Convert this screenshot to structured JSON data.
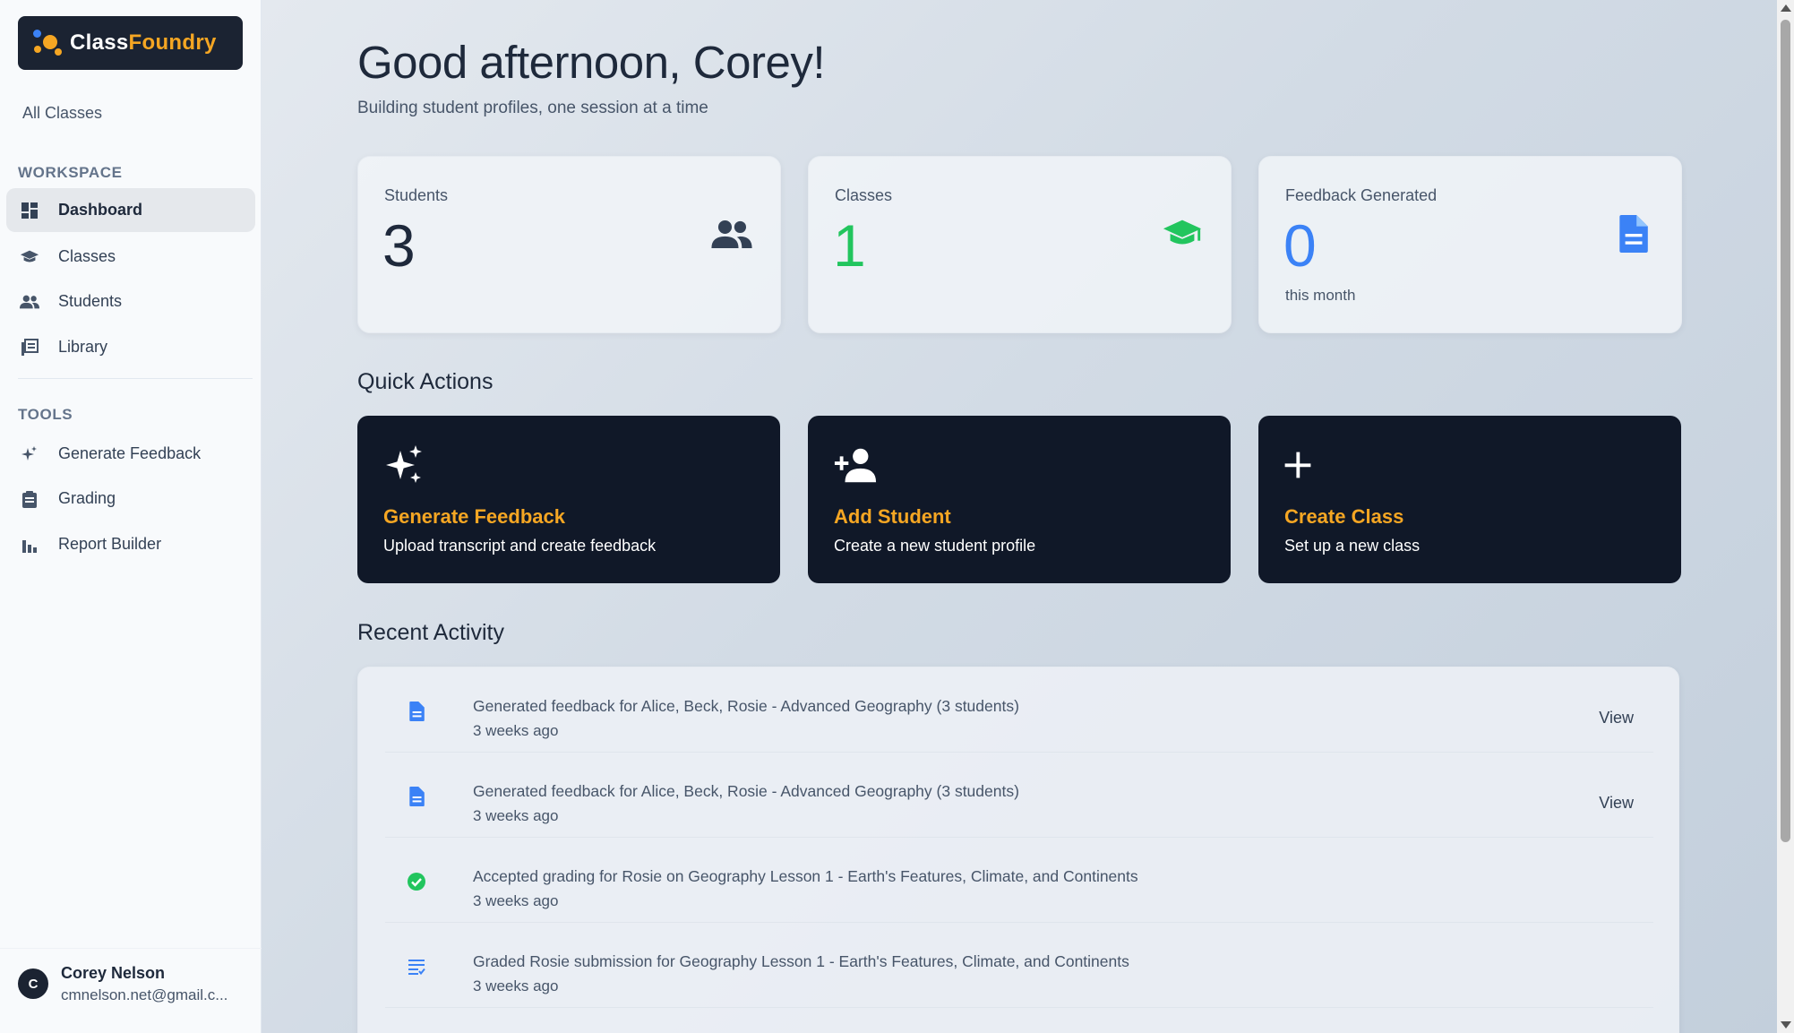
{
  "brand": {
    "part1": "Class",
    "part2": "Foundry",
    "accent": "#f5a623",
    "bg": "#1b2332"
  },
  "sidebar": {
    "all_classes": "All Classes",
    "workspace_title": "WORKSPACE",
    "workspace_items": [
      {
        "label": "Dashboard",
        "icon": "dashboard-icon",
        "active": true
      },
      {
        "label": "Classes",
        "icon": "graduation-cap-icon"
      },
      {
        "label": "Students",
        "icon": "people-icon"
      },
      {
        "label": "Library",
        "icon": "library-icon"
      }
    ],
    "tools_title": "TOOLS",
    "tools_items": [
      {
        "label": "Generate Feedback",
        "icon": "sparkle-icon"
      },
      {
        "label": "Grading",
        "icon": "clipboard-icon"
      },
      {
        "label": "Report Builder",
        "icon": "bar-chart-icon"
      }
    ],
    "user": {
      "initial": "C",
      "name": "Corey Nelson",
      "email": "cmnelson.net@gmail.c..."
    }
  },
  "main": {
    "greeting": "Good afternoon, Corey!",
    "tagline": "Building student profiles, one session at a time",
    "stats": [
      {
        "label": "Students",
        "value": "3",
        "sub": "",
        "color": "#1e293b",
        "icon": "people-icon"
      },
      {
        "label": "Classes",
        "value": "1",
        "sub": "",
        "color": "#22c55e",
        "icon": "graduation-cap-icon"
      },
      {
        "label": "Feedback Generated",
        "value": "0",
        "sub": "this month",
        "color": "#3b82f6",
        "icon": "document-icon"
      }
    ],
    "quick_actions_title": "Quick Actions",
    "quick_actions": [
      {
        "title": "Generate Feedback",
        "desc": "Upload transcript and create feedback",
        "icon": "sparkle-icon"
      },
      {
        "title": "Add Student",
        "desc": "Create a new student profile",
        "icon": "add-person-icon"
      },
      {
        "title": "Create Class",
        "desc": "Set up a new class",
        "icon": "plus-icon"
      }
    ],
    "recent_activity_title": "Recent Activity",
    "activity": [
      {
        "text": "Generated feedback for Alice, Beck, Rosie - Advanced Geography (3 students)",
        "time": "3 weeks ago",
        "icon": "document-icon",
        "action": "View"
      },
      {
        "text": "Generated feedback for Alice, Beck, Rosie - Advanced Geography (3 students)",
        "time": "3 weeks ago",
        "icon": "document-icon",
        "action": "View"
      },
      {
        "text": "Accepted grading for Rosie on Geography Lesson 1 - Earth's Features, Climate, and Continents",
        "time": "3 weeks ago",
        "icon": "check-circle-icon",
        "action": ""
      },
      {
        "text": "Graded Rosie submission for Geography Lesson 1 - Earth's Features, Climate, and Continents",
        "time": "3 weeks ago",
        "icon": "list-icon",
        "action": ""
      }
    ]
  }
}
